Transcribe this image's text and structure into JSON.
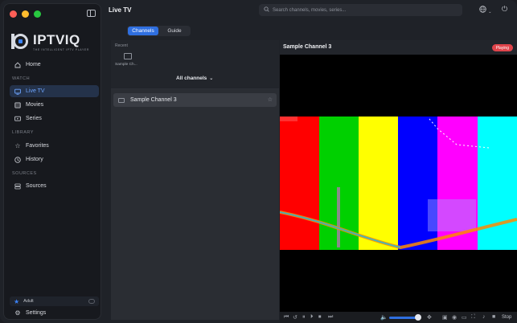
{
  "app": {
    "logo_word": "IPTVIQ",
    "logo_tagline": "THE INTELLIGENT IPTV PLAYER"
  },
  "sidebar": {
    "sections": [
      {
        "label": "WATCH"
      },
      {
        "label": "LIBRARY"
      },
      {
        "label": "SOURCES"
      }
    ],
    "items": [
      {
        "label": "Home",
        "icon": "home-icon"
      },
      {
        "label": "Live TV",
        "icon": "tv-icon",
        "active": true
      },
      {
        "label": "Movies",
        "icon": "film-icon"
      },
      {
        "label": "Series",
        "icon": "series-icon"
      },
      {
        "label": "Favorites",
        "icon": "star-icon"
      },
      {
        "label": "History",
        "icon": "clock-icon"
      },
      {
        "label": "Sources",
        "icon": "database-icon"
      },
      {
        "label": "Settings",
        "icon": "gear-icon"
      }
    ],
    "adult_label": "Adult"
  },
  "header": {
    "title": "Live TV",
    "search_placeholder": "Search channels, movies, series..."
  },
  "tabs": [
    {
      "label": "Channels",
      "active": true
    },
    {
      "label": "Guide",
      "active": false
    }
  ],
  "channel_list": {
    "recent_label": "Recent",
    "recent_item": "Sample Ch...",
    "filter_label": "All channels",
    "channels": [
      {
        "name": "Sample Channel 3",
        "selected": true
      }
    ]
  },
  "player": {
    "title": "Sample Channel 3",
    "status": "Playing",
    "volume": 0.85,
    "stop_label": "Stop"
  },
  "colors": {
    "accent": "#2f6fe0",
    "active_nav_text": "#6ea5ff",
    "playing_badge": "#e0444b"
  }
}
